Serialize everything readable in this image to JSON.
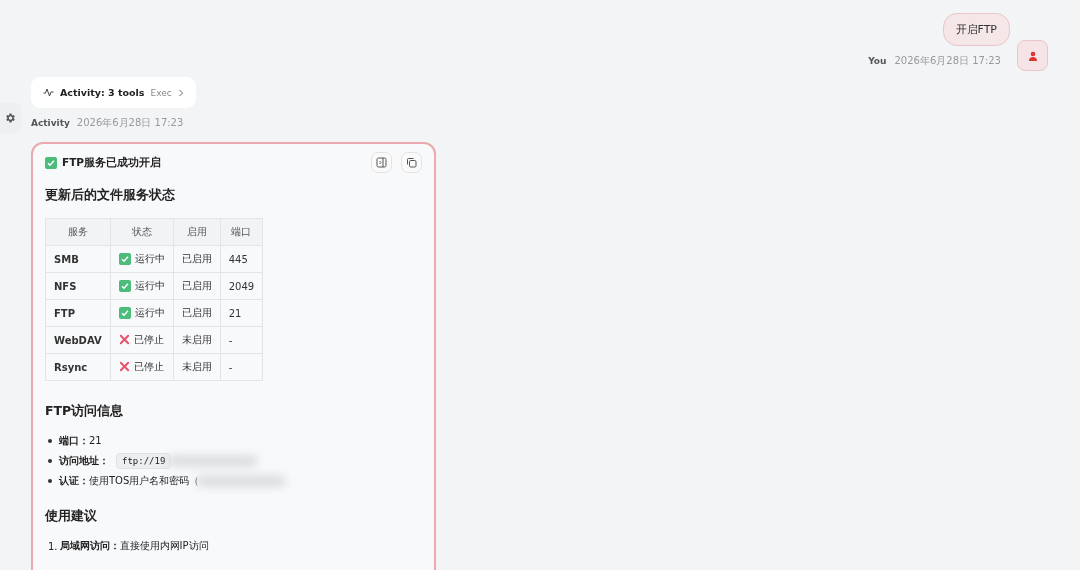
{
  "user_message": {
    "text": "开启FTP",
    "sender": "You",
    "time": "2026年6月28日 17:23"
  },
  "activity": {
    "label": "Activity: 3 tools",
    "detail": "Exec"
  },
  "assistant": {
    "sender": "Activity",
    "time": "2026年6月28日 17:23"
  },
  "card": {
    "title": "FTP服务已成功开启",
    "status_heading": "更新后的文件服务状态",
    "table": {
      "columns": [
        "服务",
        "状态",
        "启用",
        "端口"
      ],
      "rows": [
        {
          "service": "SMB",
          "status": {
            "kind": "running",
            "text": "运行中"
          },
          "enabled": "已启用",
          "port": "445"
        },
        {
          "service": "NFS",
          "status": {
            "kind": "running",
            "text": "运行中"
          },
          "enabled": "已启用",
          "port": "2049"
        },
        {
          "service": "FTP",
          "status": {
            "kind": "running",
            "text": "运行中"
          },
          "enabled": "已启用",
          "port": "21"
        },
        {
          "service": "WebDAV",
          "status": {
            "kind": "stopped",
            "text": "已停止"
          },
          "enabled": "未启用",
          "port": "-"
        },
        {
          "service": "Rsync",
          "status": {
            "kind": "stopped",
            "text": "已停止"
          },
          "enabled": "未启用",
          "port": "-"
        }
      ]
    },
    "access": {
      "heading": "FTP访问信息",
      "items": [
        {
          "kind": "text",
          "label": "端口：",
          "value": "21"
        },
        {
          "kind": "code",
          "label": "访问地址：",
          "value": "ftp://19"
        },
        {
          "kind": "text",
          "label": "认证：",
          "value": "使用TOS用户名和密码（"
        }
      ]
    },
    "tips": {
      "heading": "使用建议",
      "items": [
        {
          "number": "1.",
          "label": "局域网访问：",
          "value": "直接使用内网IP访问"
        }
      ]
    }
  }
}
